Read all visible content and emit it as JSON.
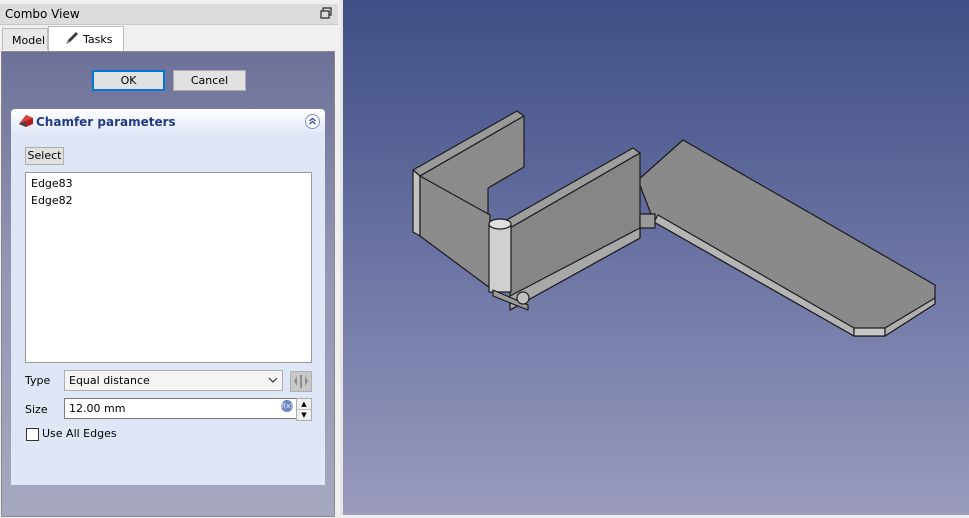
{
  "combo_view": {
    "title": "Combo View",
    "tabs": [
      {
        "label": "Model",
        "active": false
      },
      {
        "label": "Tasks",
        "active": true
      }
    ]
  },
  "dialog": {
    "ok_label": "OK",
    "cancel_label": "Cancel"
  },
  "chamfer_panel": {
    "title": "Chamfer parameters",
    "select_label": "Select",
    "edges": [
      "Edge83",
      "Edge82"
    ],
    "type_label": "Type",
    "type_value": "Equal distance",
    "size_label": "Size",
    "size_value": "12.00 mm",
    "use_all_edges_label": "Use All Edges",
    "use_all_edges_checked": false
  },
  "colors": {
    "panel_title": "#1f3c88",
    "viewport_top": "#3f4e84",
    "viewport_bottom": "#9a9bbd",
    "model_face": "#8a8a8a"
  }
}
